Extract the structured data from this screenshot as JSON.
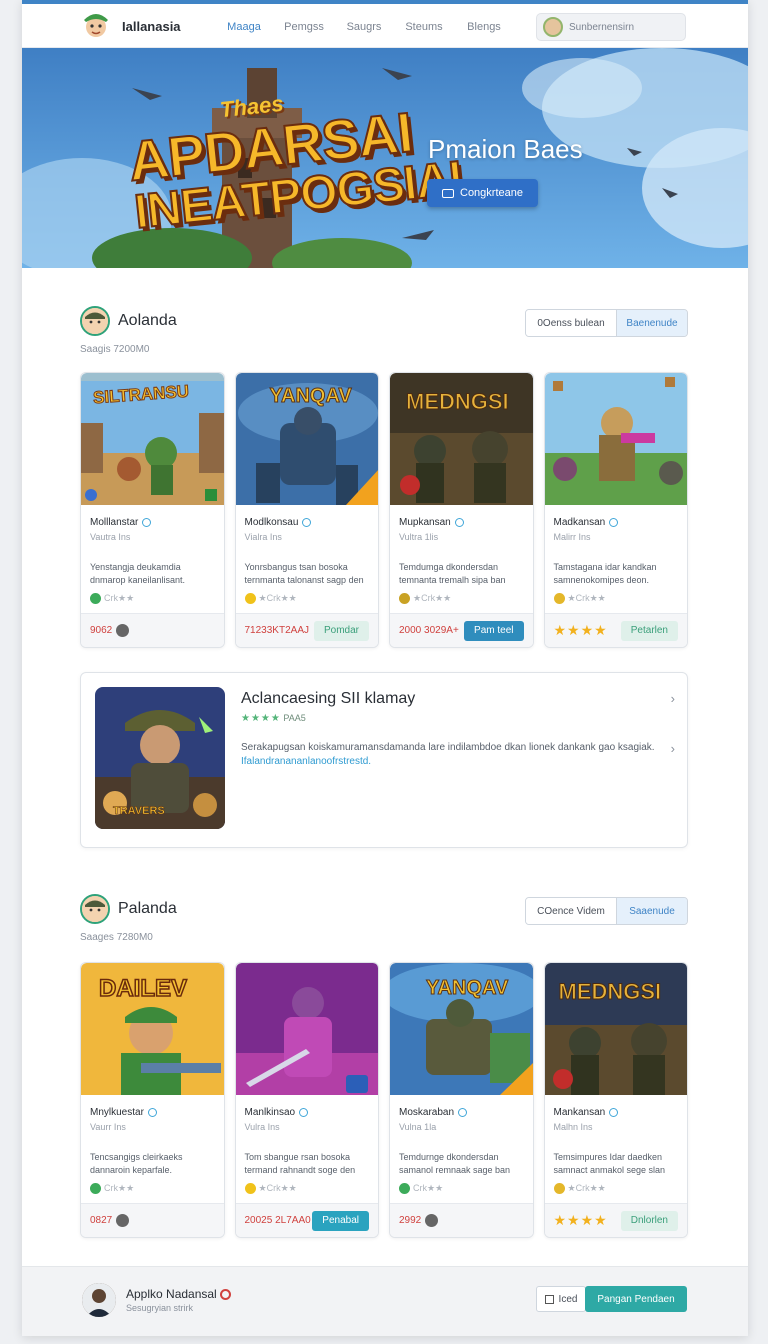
{
  "nav": {
    "brand": "Iallanasia",
    "links": [
      "Maaga",
      "Pemgss",
      "Saugrs",
      "Steums",
      "Blengs"
    ],
    "search_label": "Sunbernensirn"
  },
  "hero": {
    "art_title_small": "Thaes",
    "art_title_line1": "APDARSAI",
    "art_title_line2": "INEATPOGSIAI",
    "heading": "Pmaion Baes",
    "button_label": "Congkrteane"
  },
  "section1": {
    "title": "Aolanda",
    "subtitle": "Saagis 7200M0",
    "seg_option1": "0Oenss bulean",
    "seg_option2": "Baenenude",
    "cards": [
      {
        "art_label": "SILTRANSU",
        "name": "Molllanstar",
        "meta": "Vautra Ins",
        "desc": "Yenstangja deukamdia dnmarop kaneilanlisant.",
        "rate": "Crk★★",
        "price": "9062",
        "button": ""
      },
      {
        "art_label": "YANQAV",
        "name": "Modlkonsau",
        "meta": "Vialra Ins",
        "desc": "Yonrsbangus tsan bosoka ternmanta talonanst sagp den",
        "rate": "★Crk★★",
        "price": "71233KT2AAJ",
        "button": "Pomdar"
      },
      {
        "art_label": "MEDNGSI",
        "name": "Mupkansan",
        "meta": "Vultra 1lis",
        "desc": "Temdumga dkondersdan temnanta tremalh sipa ban",
        "rate": "★Crk★★",
        "price": "2000 3029A+",
        "button": "Pam teel"
      },
      {
        "art_label": "",
        "name": "Madkansan",
        "meta": "Malirr Ins",
        "desc": "Tamstagana idar kandkan samnenokomipes deon.",
        "rate": "★Crk★★",
        "price": "★★★★",
        "button": "Petarlen"
      }
    ]
  },
  "feature": {
    "art_label": "TRAVERS",
    "title": "Aclancaesing SII klamay",
    "rating_stars": "★★★★",
    "rating_value": "PAA5",
    "desc": "Serakapugsan koiskamuramansdamanda lare indilambdoe dkan lionek dankank gao ksagiak.",
    "link": "Ifalandranananlanoofrstrestd."
  },
  "section2": {
    "title": "Palanda",
    "subtitle": "Saages 7280M0",
    "seg_option1": "COence Videm",
    "seg_option2": "Saaenude",
    "cards": [
      {
        "art_label": "DAILEV",
        "name": "Mnylkuestar",
        "meta": "Vaurr Ins",
        "desc": "Tencsangigs cleirkaeks dannaroin keparfale.",
        "rate": "Crk★★",
        "price": "0827",
        "button": ""
      },
      {
        "art_label": "",
        "name": "Manlkinsao",
        "meta": "Vulra Ins",
        "desc": "Tom sbangue rsan bosoka termand rahnandt soge den",
        "rate": "★Crk★★",
        "price": "20025 2L7AA0",
        "button": "Penabal"
      },
      {
        "art_label": "YANQAV",
        "name": "Moskaraban",
        "meta": "Vulna 1la",
        "desc": "Temdurnge dkondersdan samanol remnaak sage ban",
        "rate": "Crk★★",
        "price": "2992",
        "button": ""
      },
      {
        "art_label": "MEDNGSI",
        "name": "Mankansan",
        "meta": "Malhn Ins",
        "desc": "Temsimpures Idar daedken samnact anmakol sege slan",
        "rate": "★Crk★★",
        "price": "★★★★",
        "button": "Dnlorlen"
      }
    ]
  },
  "footer": {
    "name": "Applko Nadansal",
    "sub": "Sesugryian strirk",
    "checkbox_label": "Iced",
    "button_label": "Pangan Pendaen"
  },
  "colors": {
    "accent": "#3f84c6",
    "price": "#d0413e",
    "teal": "#2ea9a5"
  }
}
